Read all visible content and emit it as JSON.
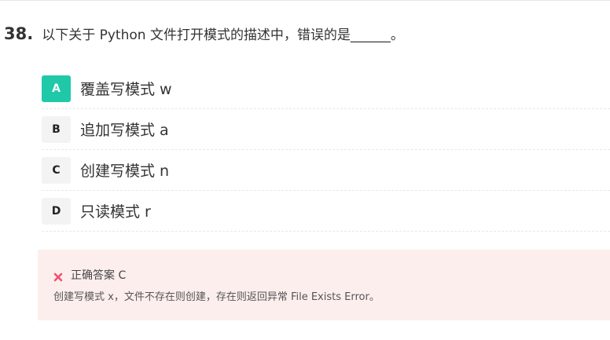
{
  "question": {
    "number": "38.",
    "text": "以下关于 Python 文件打开模式的描述中，错误的是______。"
  },
  "options": [
    {
      "letter": "A",
      "text": "覆盖写模式 w",
      "selected": true
    },
    {
      "letter": "B",
      "text": "追加写模式 a",
      "selected": false
    },
    {
      "letter": "C",
      "text": "创建写模式 n",
      "selected": false
    },
    {
      "letter": "D",
      "text": "只读模式 r",
      "selected": false
    }
  ],
  "result": {
    "icon": "cross-icon",
    "answer_label": "正确答案 C",
    "explanation": "创建写模式 x，文件不存在则创建，存在则返回异常 File Exists Error。"
  },
  "colors": {
    "selected_badge": "#1fc9a8",
    "wrong_icon": "#f0506e",
    "answer_background": "#fdeeee"
  }
}
